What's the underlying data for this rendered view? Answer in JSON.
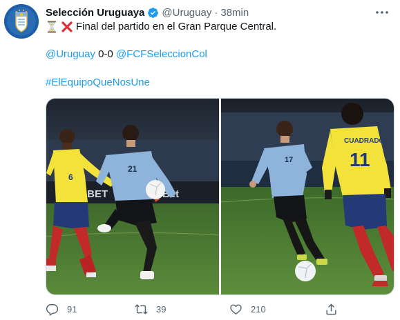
{
  "header": {
    "display_name": "Selección Uruguaya",
    "handle": "@Uruguay",
    "separator": "·",
    "time": "38min"
  },
  "tweet": {
    "line1_text": "Final del partido en el Gran Parque Central.",
    "line1_icons": [
      "hourglass-icon",
      "cross-mark-icon"
    ],
    "mention_home": "@Uruguay",
    "score": " 0-0 ",
    "mention_away": "@FCFSeleccionCol",
    "hashtag": "#ElEquipoQueNosUne"
  },
  "media": {
    "photo_left": {
      "ad_board_text": "LBET",
      "ad_board_text_2": "Bet",
      "left_player_number": "6",
      "right_player_number": "21"
    },
    "photo_right": {
      "left_player_number": "17",
      "right_player_name": "CUADRADO",
      "right_player_number": "11"
    }
  },
  "actions": {
    "replies": "91",
    "retweets": "39",
    "likes": "210"
  },
  "colors": {
    "link": "#1d9bf0",
    "secondary_text": "#536471",
    "verified": "#1d9bf0",
    "uruguay_shirt": "#8fb4dc",
    "colombia_shirt": "#f2e23a"
  }
}
